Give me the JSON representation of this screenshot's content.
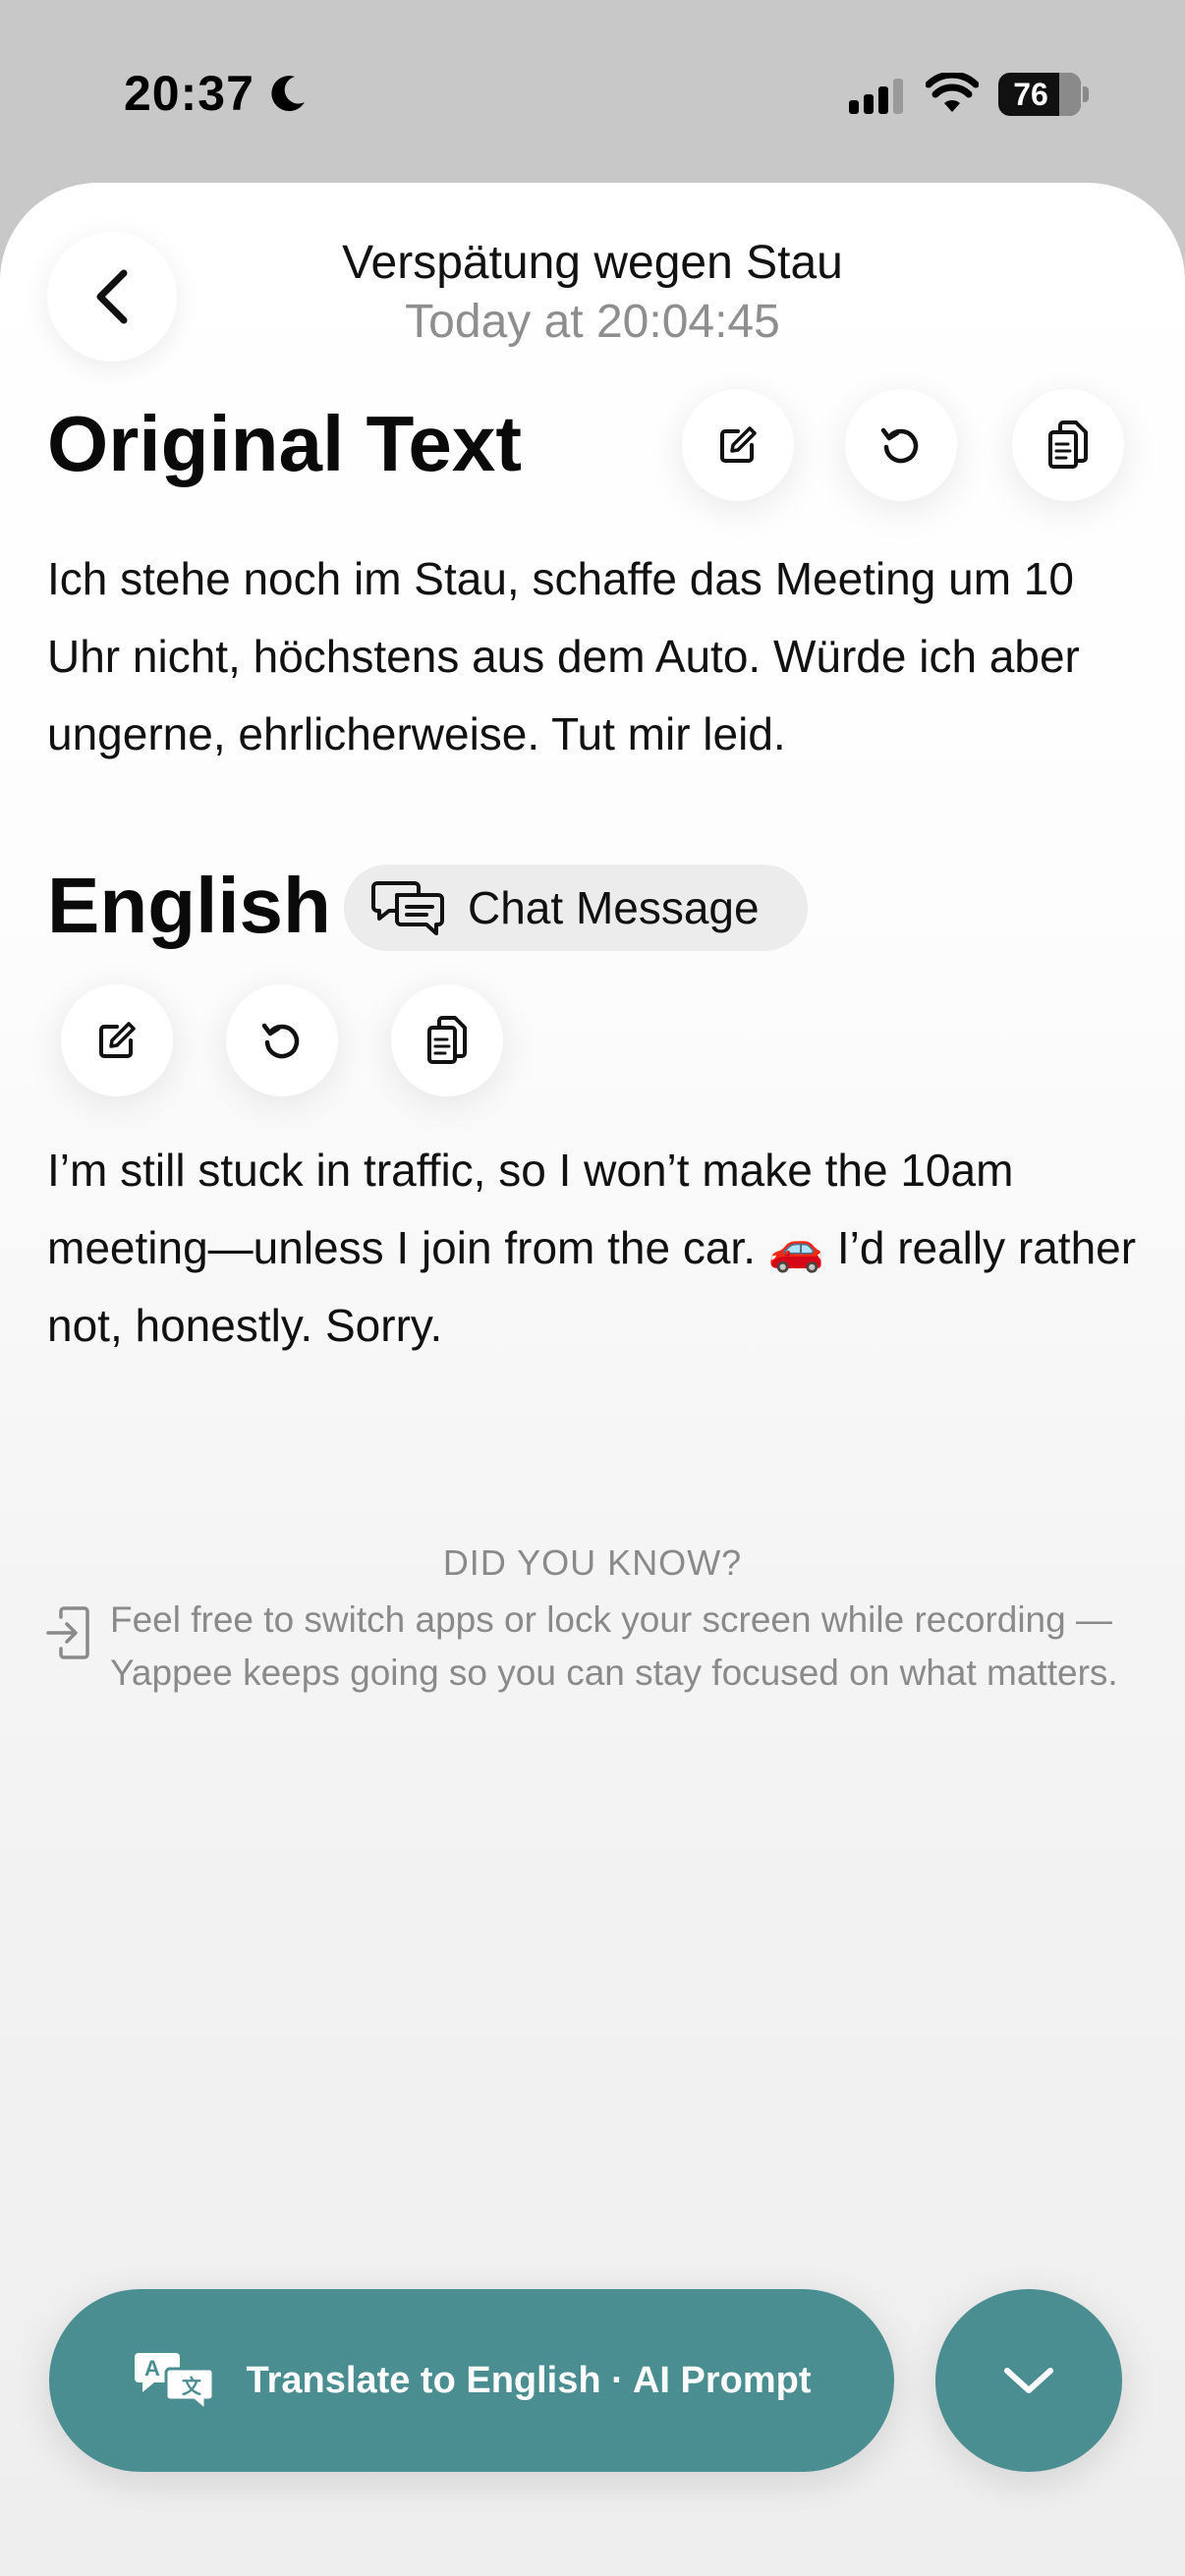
{
  "status_bar": {
    "time": "20:37",
    "battery": "76"
  },
  "header": {
    "title": "Verspätung wegen Stau",
    "subtitle": "Today at 20:04:45"
  },
  "original": {
    "heading": "Original Text",
    "text": "Ich stehe noch im Stau, schaffe das Meeting um 10 Uhr nicht, höchstens aus dem Auto. Würde ich aber ungerne, ehrlicherweise. Tut mir leid."
  },
  "translation": {
    "heading": "English",
    "chip_label": "Chat Message",
    "text": "I’m still stuck in traffic, so I won’t make the 10am meeting—unless I join from the car. 🚗 I’d really rather not, honestly. Sorry."
  },
  "did_you_know": {
    "title": "DID YOU KNOW?",
    "text": "Feel free to switch apps or lock your screen while recording — Yappee keeps going so you can stay focused on what matters."
  },
  "bottom": {
    "translate_label": "Translate to English · AI Prompt"
  },
  "colors": {
    "accent": "#4a8e92"
  }
}
